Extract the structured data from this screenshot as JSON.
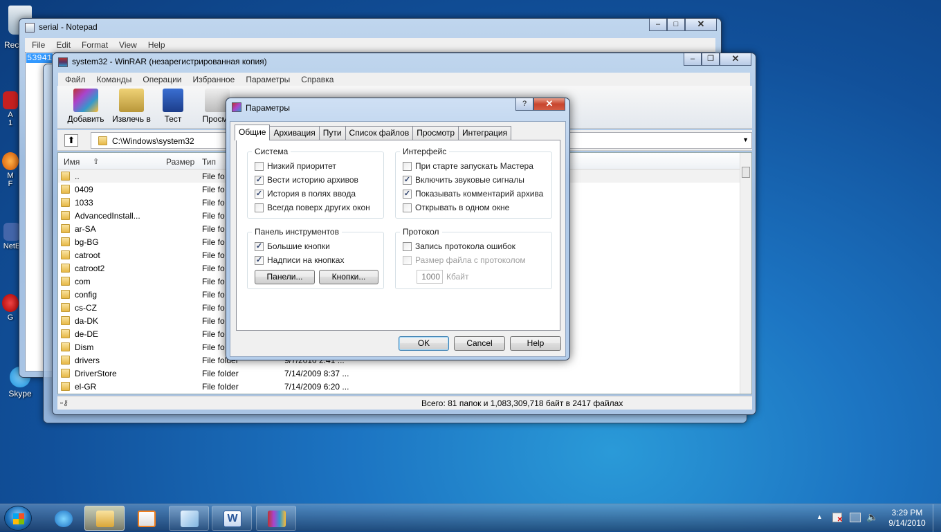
{
  "desktop": {
    "icons": [
      {
        "label": "Rec"
      },
      {
        "label": "A\n1"
      },
      {
        "label": "M\nF"
      },
      {
        "label": "NetB"
      },
      {
        "label": "G"
      },
      {
        "label": "Skype"
      }
    ]
  },
  "notepad": {
    "title": "serial - Notepad",
    "menu": [
      "File",
      "Edit",
      "Format",
      "View",
      "Help"
    ],
    "content": "53941"
  },
  "winrar": {
    "title": "system32 - WinRAR (незарегистрированная копия)",
    "menu": [
      "Файл",
      "Команды",
      "Операции",
      "Избранное",
      "Параметры",
      "Справка"
    ],
    "toolbar": [
      {
        "label": "Добавить"
      },
      {
        "label": "Извлечь в"
      },
      {
        "label": "Тест"
      },
      {
        "label": "Просмо"
      }
    ],
    "path": "C:\\Windows\\system32",
    "columns": {
      "name": "Имя",
      "size": "Размер",
      "type": "Тип"
    },
    "files": [
      {
        "name": "..",
        "type": "File fo",
        "date": ""
      },
      {
        "name": "0409",
        "type": "File fo",
        "date": ""
      },
      {
        "name": "1033",
        "type": "File fo",
        "date": ""
      },
      {
        "name": "AdvancedInstall...",
        "type": "File fo",
        "date": ""
      },
      {
        "name": "ar-SA",
        "type": "File fo",
        "date": ""
      },
      {
        "name": "bg-BG",
        "type": "File fo",
        "date": ""
      },
      {
        "name": "catroot",
        "type": "File fo",
        "date": ""
      },
      {
        "name": "catroot2",
        "type": "File fo",
        "date": ""
      },
      {
        "name": "com",
        "type": "File fo",
        "date": ""
      },
      {
        "name": "config",
        "type": "File fo",
        "date": ""
      },
      {
        "name": "cs-CZ",
        "type": "File fo",
        "date": ""
      },
      {
        "name": "da-DK",
        "type": "File fo",
        "date": ""
      },
      {
        "name": "de-DE",
        "type": "File fo",
        "date": ""
      },
      {
        "name": "Dism",
        "type": "File fo",
        "date": ""
      },
      {
        "name": "drivers",
        "type": "File folder",
        "date": "9/7/2010 2:41 ..."
      },
      {
        "name": "DriverStore",
        "type": "File folder",
        "date": "7/14/2009 8:37 ..."
      },
      {
        "name": "el-GR",
        "type": "File folder",
        "date": "7/14/2009 6:20 ..."
      }
    ],
    "status": "Всего: 81 папок и 1,083,309,718 байт в 2417 файлах"
  },
  "dialog": {
    "title": "Параметры",
    "tabs": [
      "Общие",
      "Архивация",
      "Пути",
      "Список файлов",
      "Просмотр",
      "Интеграция"
    ],
    "groups": {
      "system": {
        "label": "Система",
        "items": [
          {
            "label": "Низкий приоритет",
            "checked": false
          },
          {
            "label": "Вести историю архивов",
            "checked": true
          },
          {
            "label": "История в полях ввода",
            "checked": true
          },
          {
            "label": "Всегда поверх других окон",
            "checked": false
          }
        ]
      },
      "interface": {
        "label": "Интерфейс",
        "items": [
          {
            "label": "При старте запускать Мастера",
            "checked": false
          },
          {
            "label": "Включить звуковые сигналы",
            "checked": true
          },
          {
            "label": "Показывать комментарий архива",
            "checked": true
          },
          {
            "label": "Открывать в одном окне",
            "checked": false
          }
        ]
      },
      "toolbar": {
        "label": "Панель инструментов",
        "items": [
          {
            "label": "Большие кнопки",
            "checked": true
          },
          {
            "label": "Надписи на кнопках",
            "checked": true
          }
        ],
        "btn_panels": "Панели...",
        "btn_buttons": "Кнопки..."
      },
      "log": {
        "label": "Протокол",
        "items": [
          {
            "label": "Запись протокола ошибок",
            "checked": false
          },
          {
            "label": "Размер файла с протоколом",
            "checked": false,
            "disabled": true
          }
        ],
        "size_value": "1000",
        "size_unit": "Кбайт"
      }
    },
    "buttons": {
      "ok": "OK",
      "cancel": "Cancel",
      "help": "Help"
    },
    "help_glyph": "?"
  },
  "taskbar": {
    "time": "3:29 PM",
    "date": "9/14/2010"
  },
  "colors": {
    "accent": "#1c74c2",
    "selection": "#3399ff"
  }
}
